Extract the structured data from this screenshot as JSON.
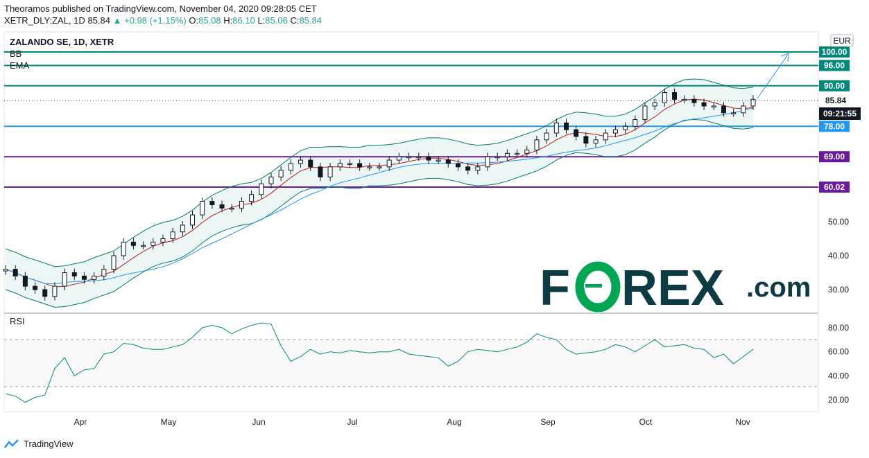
{
  "header": {
    "publisher_line": "Theoramos published on TradingView.com, November 04, 2020 09:28:05 CET",
    "symbol": "XETR_DLY:ZAL, 1D",
    "last": "85.84",
    "change": "+0.98 (+1.15%)",
    "o_label": "O:",
    "o": "85.08",
    "h_label": "H:",
    "h": "86.10",
    "l_label": "L:",
    "l": "85.06",
    "c_label": "C:",
    "c": "85.84"
  },
  "legend": {
    "title": "ZALANDO SE, 1D, XETR",
    "indicator1": "BB",
    "indicator2": "EMA"
  },
  "currency": "EUR",
  "rsi_label": "RSI",
  "footer": {
    "brand": "TradingView"
  },
  "watermark": {
    "part1": "F",
    "part2": "REX",
    "part3": ".com"
  },
  "colors": {
    "up": "#26a69a",
    "teal_line": "#00897b",
    "blue_line": "#2196f3",
    "purple_line": "#6a1b9a",
    "ema_red": "#b71c1c",
    "bb_green": "#00796b",
    "brand_dark": "#0e3b43",
    "brand_green": "#00a651"
  },
  "chart_data": {
    "type": "candlestick",
    "title": "ZALANDO SE, 1D, XETR",
    "currency": "EUR",
    "y_ticks": [
      "30.00",
      "40.00",
      "50.00"
    ],
    "x_ticks": [
      "Apr",
      "May",
      "Jun",
      "Jul",
      "Aug",
      "Sep",
      "Oct",
      "Nov"
    ],
    "levels": [
      {
        "value": 100.0,
        "label": "100.00",
        "color": "#00897b"
      },
      {
        "value": 96.0,
        "label": "96.00",
        "color": "#00897b"
      },
      {
        "value": 90.0,
        "label": "90.00",
        "color": "#00897b"
      },
      {
        "value": 78.0,
        "label": "78.00",
        "color": "#2196f3"
      },
      {
        "value": 69.0,
        "label": "69.00",
        "color": "#6a1b9a"
      },
      {
        "value": 60.02,
        "label": "60.02",
        "color": "#6a1b9a"
      }
    ],
    "last_price": {
      "value": 85.84,
      "label": "85.84"
    },
    "clock": "09:21:55",
    "close_path": [
      36,
      34,
      31,
      30,
      28,
      31,
      35,
      34,
      33,
      34,
      36,
      40,
      44,
      43,
      43,
      44,
      45,
      47,
      49,
      52,
      56,
      55,
      54,
      54,
      56,
      58,
      61,
      63,
      65,
      67,
      68,
      66,
      63,
      66,
      67,
      67,
      66,
      66,
      66,
      68,
      69,
      69,
      69,
      68,
      68,
      67,
      66,
      65,
      66,
      69,
      69,
      70,
      70,
      71,
      74,
      76,
      79,
      77,
      75,
      73,
      74,
      76,
      77,
      78,
      80,
      84,
      85,
      88,
      86,
      86,
      85,
      84,
      84,
      82,
      82,
      84,
      86
    ],
    "rsi": {
      "ticks": [
        "20.00",
        "40.00",
        "60.00",
        "80.00"
      ],
      "upper": 70,
      "lower": 30,
      "values": [
        25,
        23,
        18,
        22,
        24,
        46,
        55,
        40,
        45,
        46,
        58,
        60,
        67,
        66,
        63,
        62,
        62,
        64,
        66,
        72,
        80,
        82,
        80,
        75,
        79,
        82,
        84,
        83,
        65,
        52,
        56,
        62,
        58,
        60,
        59,
        61,
        60,
        59,
        60,
        60,
        62,
        58,
        57,
        56,
        55,
        48,
        52,
        60,
        62,
        61,
        60,
        62,
        64,
        68,
        75,
        72,
        70,
        62,
        58,
        59,
        60,
        62,
        66,
        64,
        60,
        65,
        70,
        64,
        65,
        66,
        63,
        62,
        55,
        58,
        50,
        56,
        62
      ]
    }
  }
}
